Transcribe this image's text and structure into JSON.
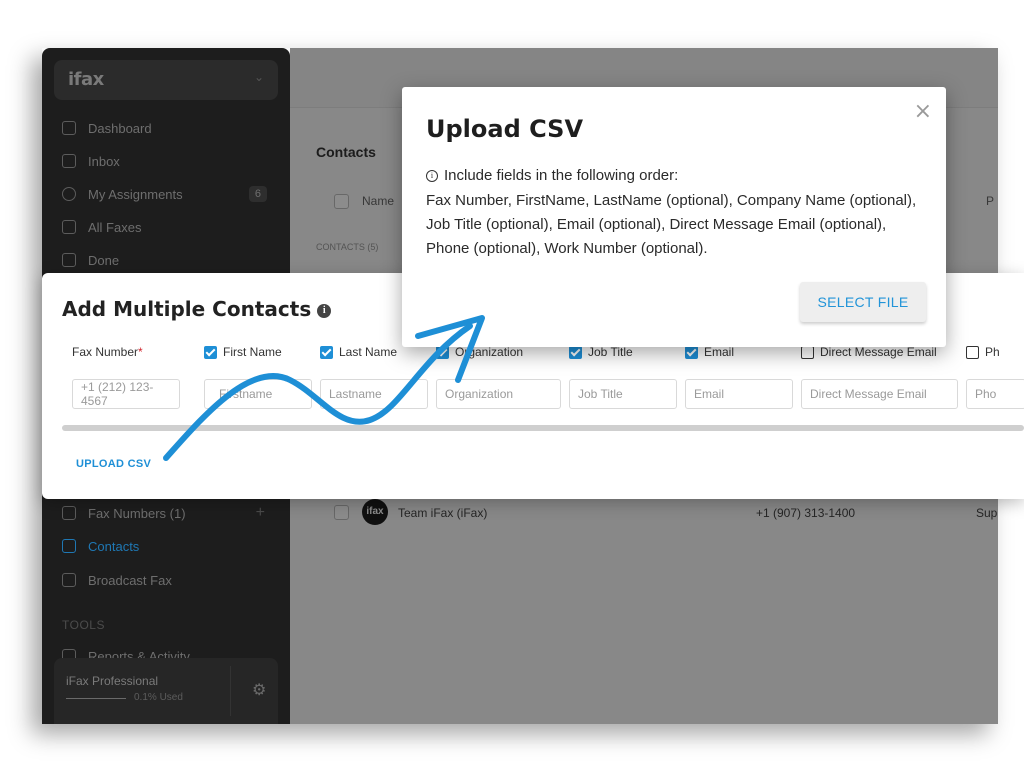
{
  "app": {
    "logo_text": "ifax"
  },
  "sidebar": {
    "items": [
      {
        "label": "Dashboard",
        "icon": "home-icon"
      },
      {
        "label": "Inbox",
        "icon": "inbox-icon"
      },
      {
        "label": "My Assignments",
        "icon": "assignments-icon",
        "badge": "6"
      },
      {
        "label": "All Faxes",
        "icon": "printer-icon"
      },
      {
        "label": "Done",
        "icon": "done-icon"
      },
      {
        "label": "Fax Numbers (1)",
        "icon": "grid-icon"
      },
      {
        "label": "Contacts",
        "icon": "contacts-icon"
      },
      {
        "label": "Broadcast Fax",
        "icon": "megaphone-icon"
      },
      {
        "label": "Reports & Activity",
        "icon": "chart-icon"
      }
    ],
    "tools_label": "TOOLS",
    "plan": {
      "name": "iFax Professional",
      "used": "0.1% Used"
    }
  },
  "main": {
    "title": "Contacts",
    "column_name": "Name",
    "column_p": "P",
    "contacts_count": "CONTACTS (5)",
    "row": {
      "avatar": "ifax",
      "name": "Team iFax (iFax)",
      "phone": "+1 (907) 313-1400",
      "role": "Sup"
    }
  },
  "add_contacts": {
    "title": "Add Multiple Contacts",
    "required_marker": "*",
    "fields": [
      {
        "label": "Fax Number",
        "required": true,
        "checked": null,
        "placeholder": "+1 (212) 123-4567"
      },
      {
        "label": "First Name",
        "checked": true,
        "placeholder": "Firstname"
      },
      {
        "label": "Last Name",
        "checked": true,
        "placeholder": "Lastname"
      },
      {
        "label": "Organization",
        "checked": true,
        "placeholder": "Organization"
      },
      {
        "label": "Job Title",
        "checked": true,
        "placeholder": "Job Title"
      },
      {
        "label": "Email",
        "checked": true,
        "placeholder": "Email"
      },
      {
        "label": "Direct Message Email",
        "checked": false,
        "placeholder": "Direct Message Email"
      },
      {
        "label": "Ph",
        "checked": false,
        "placeholder": "Pho"
      }
    ],
    "upload_link": "UPLOAD CSV"
  },
  "modal": {
    "title": "Upload CSV",
    "hint": "Include fields in the following order:",
    "body": "Fax Number, FirstName, LastName (optional), Company Name (optional), Job Title (optional), Email (optional), Direct Message Email (optional), Phone (optional), Work Number (optional).",
    "button": "SELECT FILE",
    "close_icon": "close-icon"
  },
  "colors": {
    "accent": "#1e8fd6",
    "sidebar_bg": "#1d1d1d",
    "required": "#d0232c"
  }
}
